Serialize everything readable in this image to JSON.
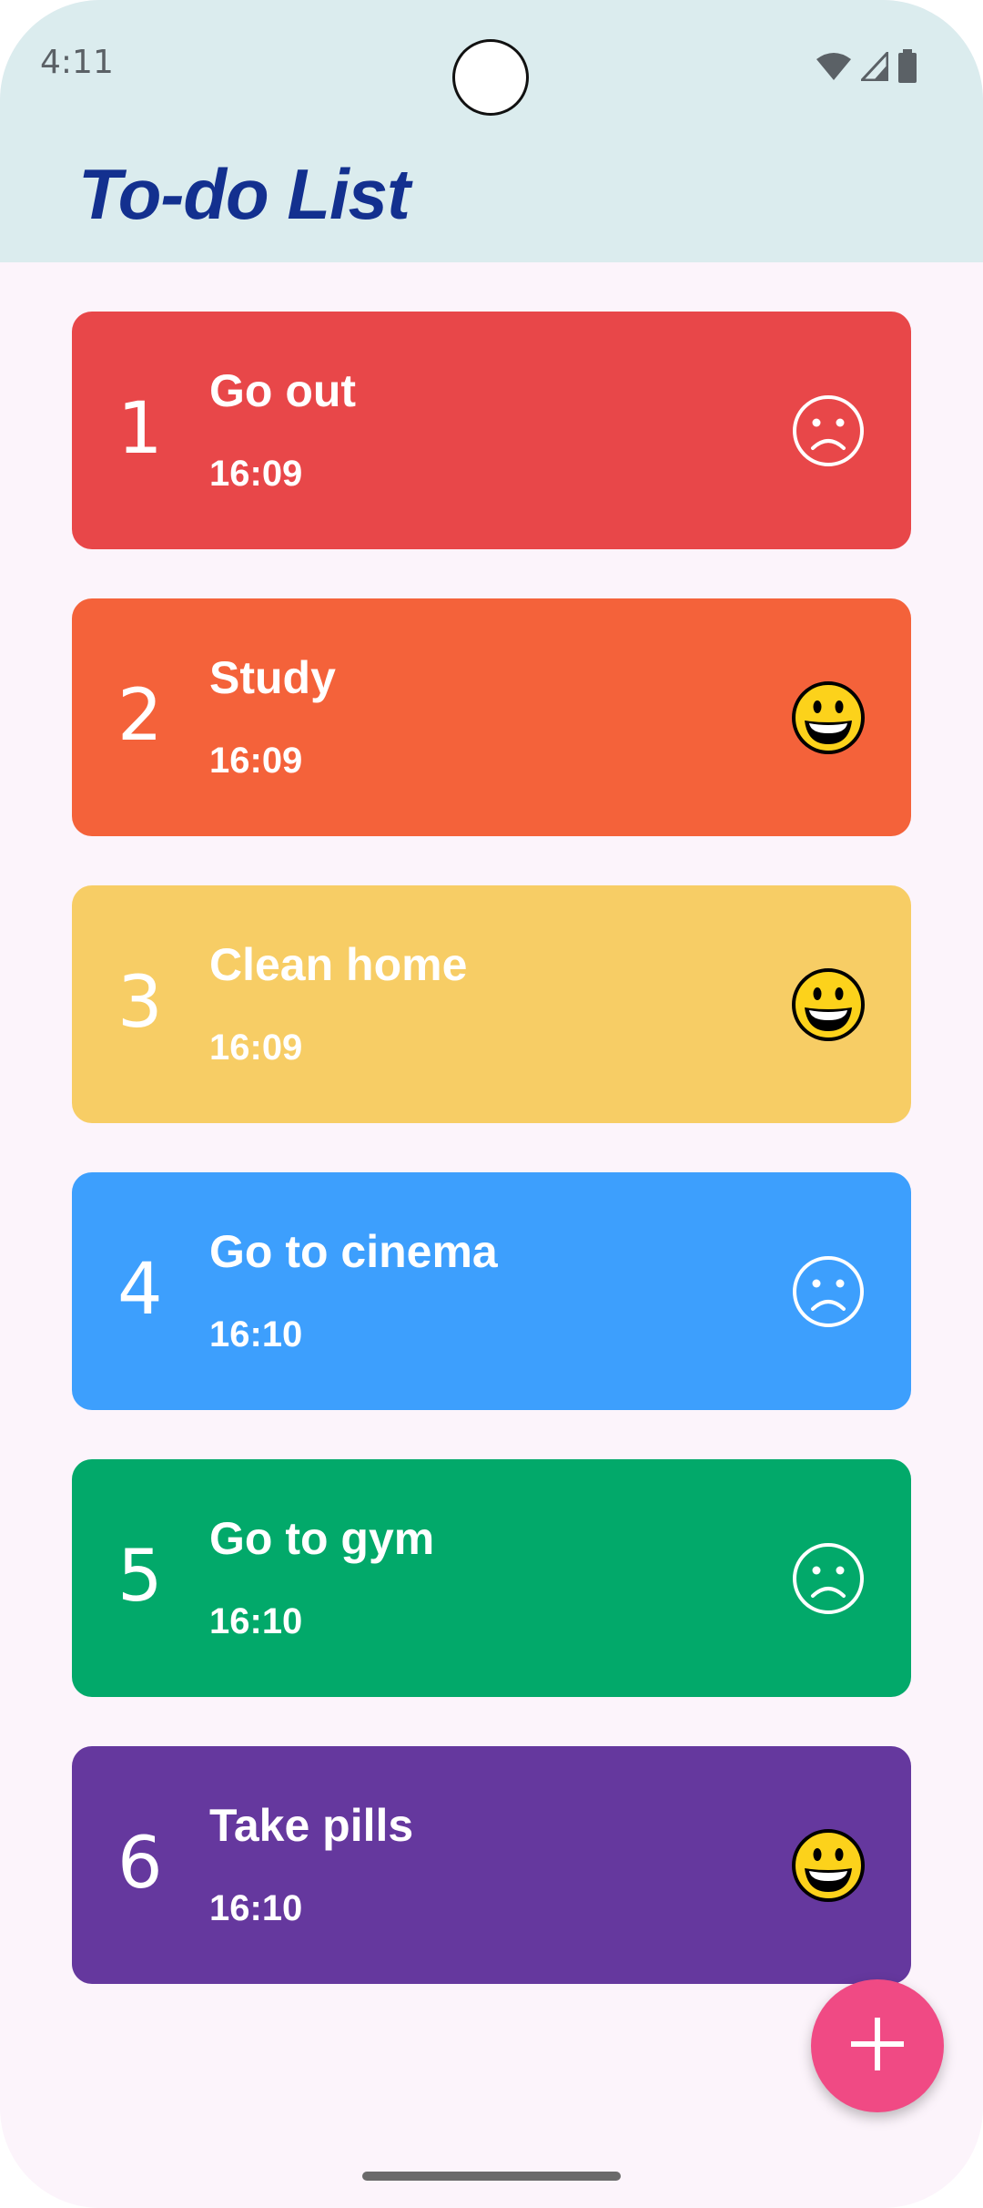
{
  "status_bar": {
    "time": "4:11",
    "icons": [
      "wifi-icon",
      "cell-signal-icon",
      "battery-icon"
    ]
  },
  "app_bar": {
    "title": "To-do List",
    "background": "#dbecee",
    "title_color": "#13308f"
  },
  "tasks": [
    {
      "number": "1",
      "title": "Go out",
      "time": "16:09",
      "mood": "sad-face-icon",
      "color": "#e84749"
    },
    {
      "number": "2",
      "title": "Study",
      "time": "16:09",
      "mood": "grinning-face-icon",
      "color": "#f4623a"
    },
    {
      "number": "3",
      "title": "Clean home",
      "time": "16:09",
      "mood": "grinning-face-icon",
      "color": "#f7cd65"
    },
    {
      "number": "4",
      "title": "Go to cinema",
      "time": "16:10",
      "mood": "sad-face-icon",
      "color": "#3d9ffd"
    },
    {
      "number": "5",
      "title": "Go to gym",
      "time": "16:10",
      "mood": "sad-face-icon",
      "color": "#02a96a"
    },
    {
      "number": "6",
      "title": "Take pills",
      "time": "16:10",
      "mood": "grinning-face-icon",
      "color": "#65389e"
    }
  ],
  "fab": {
    "icon": "plus-icon",
    "color": "#f04a84"
  }
}
